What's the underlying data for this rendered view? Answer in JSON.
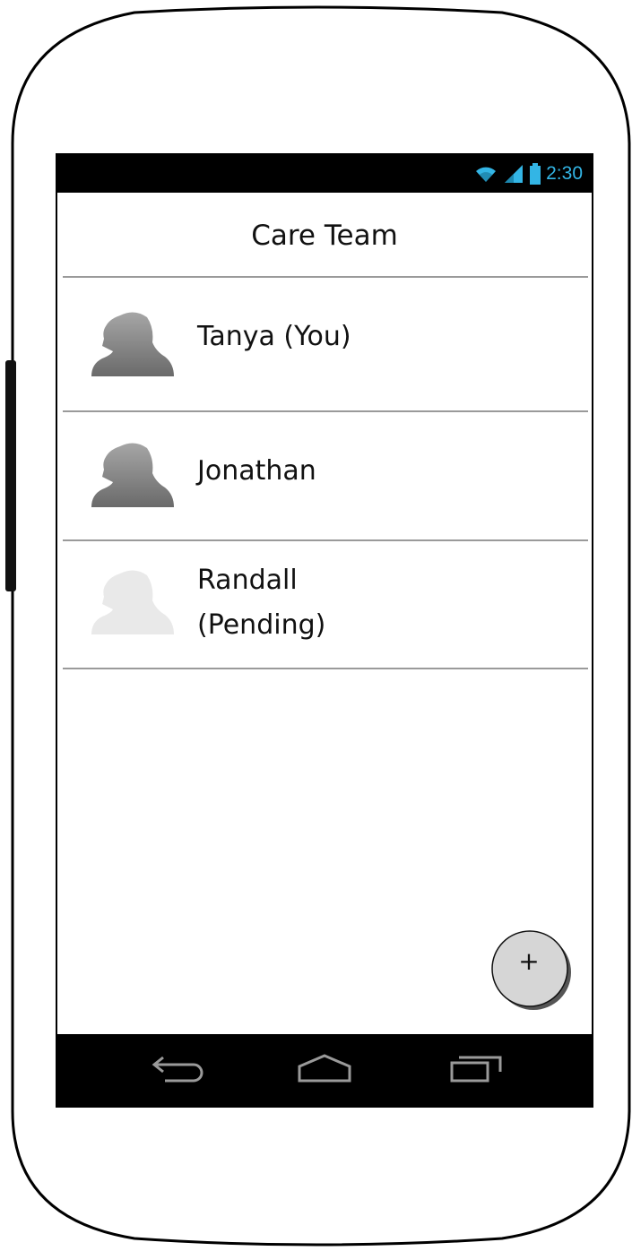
{
  "status_bar": {
    "time": "2:30",
    "icons": [
      "wifi-icon",
      "signal-icon",
      "battery-icon"
    ],
    "accent_color": "#33b5e5"
  },
  "header": {
    "title": "Care Team"
  },
  "members": [
    {
      "name": "Tanya (You)",
      "status": "",
      "pending": false
    },
    {
      "name": "Jonathan",
      "status": "",
      "pending": false
    },
    {
      "name": "Randall",
      "status": "(Pending)",
      "pending": true
    }
  ],
  "fab": {
    "label": "+",
    "icon": "add-icon"
  },
  "nav_bar": {
    "buttons": [
      "back-icon",
      "home-icon",
      "recent-apps-icon"
    ]
  },
  "colors": {
    "avatar_active": "#7f7f7f",
    "avatar_pending": "#e9e9e9",
    "divider": "#9a9a9a"
  }
}
